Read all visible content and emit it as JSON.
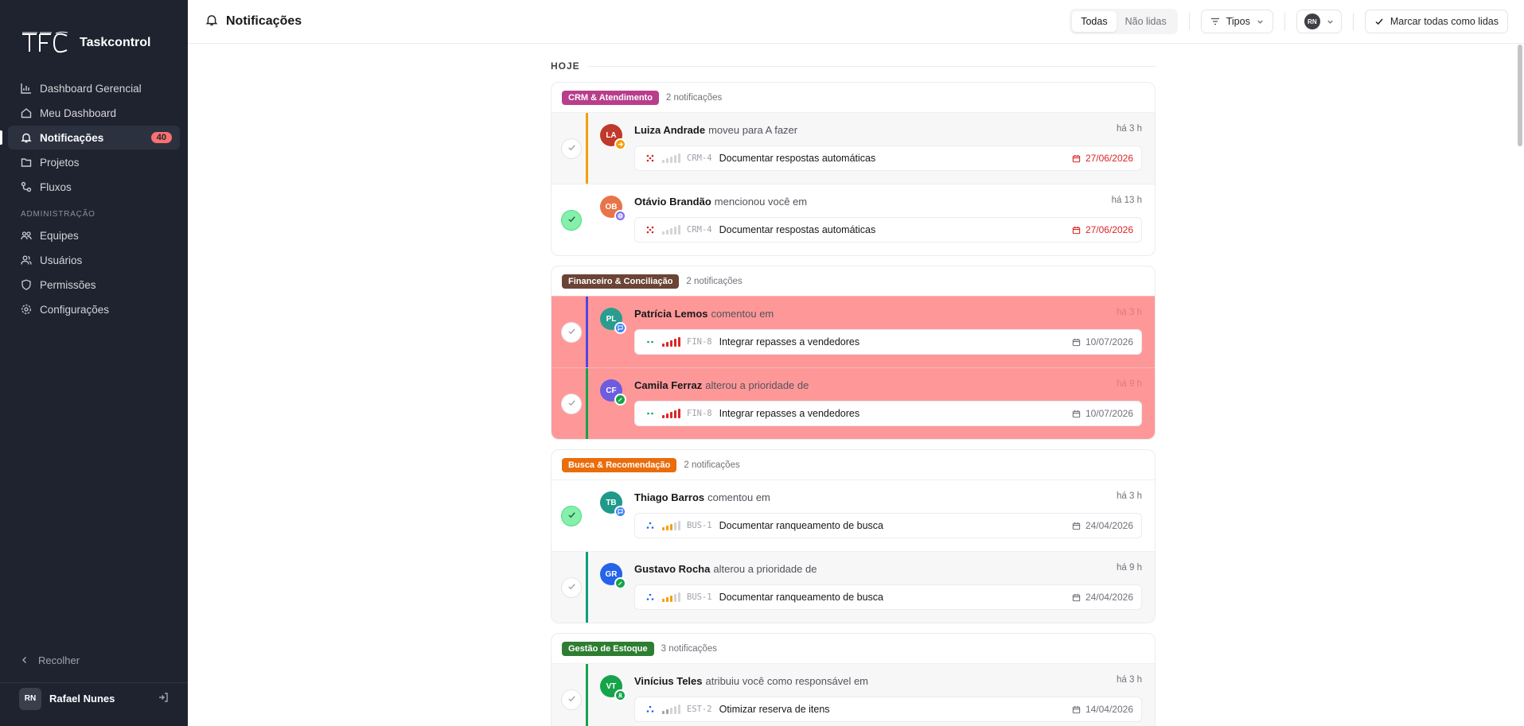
{
  "app": {
    "name": "Taskcontrol",
    "logo_text": "TFC"
  },
  "sidebar": {
    "nav": [
      {
        "label": "Dashboard Gerencial",
        "icon": "bar-chart-icon"
      },
      {
        "label": "Meu Dashboard",
        "icon": "home-icon"
      },
      {
        "label": "Notificações",
        "icon": "bell-icon",
        "active": true,
        "badge": "40"
      },
      {
        "label": "Projetos",
        "icon": "folder-icon"
      },
      {
        "label": "Fluxos",
        "icon": "workflow-icon"
      }
    ],
    "admin_label": "ADMINISTRAÇÃO",
    "admin": [
      {
        "label": "Equipes",
        "icon": "team-icon"
      },
      {
        "label": "Usuários",
        "icon": "users-icon"
      },
      {
        "label": "Permissões",
        "icon": "shield-icon"
      },
      {
        "label": "Configurações",
        "icon": "gear-icon"
      }
    ],
    "collapse_label": "Recolher",
    "user": {
      "initials": "RN",
      "name": "Rafael Nunes"
    }
  },
  "topbar": {
    "title": "Notificações",
    "filter_all": "Todas",
    "filter_unread": "Não lidas",
    "types_label": "Tipos",
    "user_initials": "RN",
    "mark_all_label": "Marcar todas como lidas"
  },
  "feed": {
    "day_label": "HOJE",
    "groups": [
      {
        "tag": "CRM & Atendimento",
        "tag_color": "#b83e8c",
        "count": "2 notificações",
        "items": [
          {
            "actor": "Luiza Andrade",
            "action": "moveu para A fazer",
            "ago": "há 3 h",
            "initials": "LA",
            "avatar_color": "#c0392b",
            "badge_color": "#f59e0b",
            "badge_icon": "arrow-icon",
            "accent": "#f59e0b",
            "state": "unread",
            "done": false,
            "task": {
              "icon": "priority-urgent-icon",
              "key": "CRM-4",
              "title": "Documentar respostas automáticas",
              "date": "27/06/2026",
              "overdue": true,
              "level": 0
            }
          },
          {
            "actor": "Otávio Brandão",
            "action": "mencionou você em",
            "ago": "há 13 h",
            "initials": "OB",
            "avatar_color": "#e8744a",
            "badge_color": "#7c6cf0",
            "badge_icon": "at-icon",
            "accent": "",
            "state": "read",
            "done": true,
            "task": {
              "icon": "priority-urgent-icon",
              "key": "CRM-4",
              "title": "Documentar respostas automáticas",
              "date": "27/06/2026",
              "overdue": true,
              "level": 0
            }
          }
        ]
      },
      {
        "tag": "Financeiro & Conciliação",
        "tag_color": "#6b4436",
        "count": "2 notificações",
        "items": [
          {
            "actor": "Patrícia Lemos",
            "action": "comentou em",
            "ago": "há 3 h",
            "initials": "PL",
            "avatar_color": "#2a9d8f",
            "badge_color": "#3b82f6",
            "badge_icon": "comment-icon",
            "accent": "#4f46e5",
            "state": "highlight",
            "done": false,
            "task": {
              "icon": "status-dots-icon",
              "key": "FIN-8",
              "title": "Integrar repasses a vendedores",
              "date": "10/07/2026",
              "overdue": false,
              "level": 5
            }
          },
          {
            "actor": "Camila Ferraz",
            "action": "alterou a prioridade de",
            "ago": "há 9 h",
            "initials": "CF",
            "avatar_color": "#6d5ce0",
            "badge_color": "#16a34a",
            "badge_icon": "pencil-icon",
            "accent": "#16a34a",
            "state": "highlight",
            "done": false,
            "task": {
              "icon": "status-dots-icon",
              "key": "FIN-8",
              "title": "Integrar repasses a vendedores",
              "date": "10/07/2026",
              "overdue": false,
              "level": 5
            }
          }
        ]
      },
      {
        "tag": "Busca & Recomendação",
        "tag_color": "#ea6d0c",
        "count": "2 notificações",
        "items": [
          {
            "actor": "Thiago Barros",
            "action": "comentou em",
            "ago": "há 3 h",
            "initials": "TB",
            "avatar_color": "#1f9a8a",
            "badge_color": "#3b82f6",
            "badge_icon": "comment-icon",
            "accent": "",
            "state": "read",
            "done": true,
            "task": {
              "icon": "status-progress-icon",
              "key": "BUS-1",
              "title": "Documentar ranqueamento de busca",
              "date": "24/04/2026",
              "overdue": false,
              "level": 3
            }
          },
          {
            "actor": "Gustavo Rocha",
            "action": "alterou a prioridade de",
            "ago": "há 9 h",
            "initials": "GR",
            "avatar_color": "#2563eb",
            "badge_color": "#16a34a",
            "badge_icon": "pencil-icon",
            "accent": "#0f9d7a",
            "state": "unread",
            "done": false,
            "task": {
              "icon": "status-progress-icon",
              "key": "BUS-1",
              "title": "Documentar ranqueamento de busca",
              "date": "24/04/2026",
              "overdue": false,
              "level": 3
            }
          }
        ]
      },
      {
        "tag": "Gestão de Estoque",
        "tag_color": "#2e7d32",
        "count": "3 notificações",
        "items": [
          {
            "actor": "Vinícius Teles",
            "action": "atribuiu você como responsável em",
            "ago": "há 3 h",
            "initials": "VT",
            "avatar_color": "#16a34a",
            "badge_color": "#16a34a",
            "badge_icon": "user-icon",
            "accent": "#16a34a",
            "state": "unread",
            "done": false,
            "task": {
              "icon": "status-progress-icon",
              "key": "EST-2",
              "title": "Otimizar reserva de itens",
              "date": "14/04/2026",
              "overdue": false,
              "level": 2
            }
          }
        ]
      }
    ]
  },
  "colors": {
    "sidebar_bg": "#1f2330",
    "highlight_row": "#fe9898",
    "overdue": "#dc2626",
    "done_check": "#86efac"
  }
}
